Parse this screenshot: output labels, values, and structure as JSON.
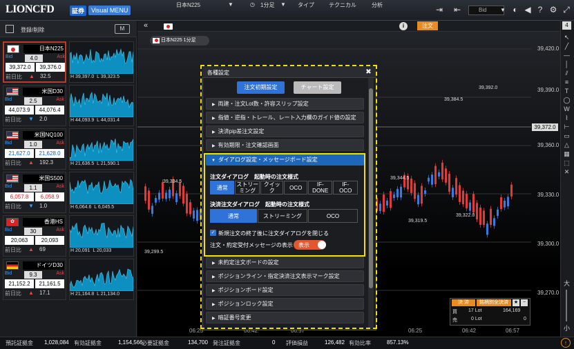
{
  "app": {
    "logo": "LIONCFD",
    "logo_badge": "証券",
    "visual_menu": "Visual MENU",
    "bid_select": "Bid"
  },
  "watchlist": {
    "title": "登録/削除",
    "m_button": "M",
    "tiles": [
      {
        "name": "日本N225",
        "flag": "jp",
        "bid_label": "Bid",
        "ask_label": "Ask",
        "spread": "4.0",
        "bid": "39,372.0",
        "ask": "39,376.0",
        "prev_label": "前日比",
        "direction": "up",
        "change": "32.5",
        "high": "H 39,397.0",
        "low": "L 39,323.5",
        "bid_color": "normal",
        "ask_color": "normal",
        "selected": true
      },
      {
        "name": "米国D30",
        "flag": "us",
        "bid_label": "Bid",
        "ask_label": "Ask",
        "spread": "2.5",
        "bid": "44,073.9",
        "ask": "44,076.4",
        "prev_label": "前日比",
        "direction": "down",
        "change": "2.0",
        "high": "H 44,093.9",
        "low": "L 44,031.4",
        "bid_color": "normal",
        "ask_color": "normal",
        "selected": false
      },
      {
        "name": "米国NQ100",
        "flag": "us",
        "bid_label": "Bid",
        "ask_label": "Ask",
        "spread": "1.0",
        "bid": "21,627.0",
        "ask": "21,628.0",
        "prev_label": "前日比",
        "direction": "up",
        "change": "192.3",
        "high": "H 21,636.5",
        "low": "L 21,590.1",
        "bid_color": "blue",
        "ask_color": "blue",
        "selected": false
      },
      {
        "name": "米国S500",
        "flag": "us",
        "bid_label": "Bid",
        "ask_label": "Ask",
        "spread": "1.1",
        "bid": "6,057.8",
        "ask": "6,058.9",
        "prev_label": "前日比",
        "direction": "down",
        "change": "1.0",
        "high": "H 6,064.6",
        "low": "L 6,045.5",
        "bid_color": "red",
        "ask_color": "red",
        "selected": false
      },
      {
        "name": "香港HS",
        "flag": "hk",
        "bid_label": "Bid",
        "ask_label": "Ask",
        "spread": "30",
        "bid": "20,063",
        "ask": "20,093",
        "prev_label": "前日比",
        "direction": "up",
        "change": "69",
        "high": "H 20,091",
        "low": "L 20,033",
        "bid_color": "normal",
        "ask_color": "normal",
        "selected": false
      },
      {
        "name": "ドイツD30",
        "flag": "de",
        "bid_label": "Bid",
        "ask_label": "Ask",
        "spread": "9.3",
        "bid": "21,152.2",
        "ask": "21,161.5",
        "prev_label": "前日比",
        "direction": "up",
        "change": "17.1",
        "high": "H 21,164.8",
        "low": "L 21,134.0",
        "bid_color": "normal",
        "ask_color": "normal",
        "selected": false
      }
    ]
  },
  "chart_toolbar": {
    "symbol": "日本N225",
    "interval": "1分足",
    "type": "タイプ",
    "technical": "テクニカル",
    "analysis": "分析",
    "info": "i",
    "order": "注文"
  },
  "chart": {
    "title_pill": "日本N225 1分足",
    "price_labels": [
      "39,420.0",
      "39,390.0",
      "39,360.0",
      "39,330.0",
      "39,300.0",
      "39,270.0"
    ],
    "current_price": "39,372.0",
    "time_labels": [
      "06:25",
      "06:42",
      "06:57",
      "06:25",
      "06:42",
      "06:57"
    ],
    "annotations": [
      "39,334.5",
      "39,299.5",
      "39,392.0",
      "39,384.5",
      "39,344.5",
      "39,319.5",
      "39,322.0"
    ]
  },
  "order_panel": {
    "settle": "決 済",
    "by_symbol": "銘柄別全決済",
    "buy_label": "買",
    "buy_lot": "17 Lot",
    "buy_price": "164,169",
    "sell_label": "売",
    "sell_lot": "0 Lot",
    "sell_price": "0"
  },
  "dialog": {
    "title": "各種設定",
    "tab_order": "注文初期設定",
    "tab_chart": "チャート設定",
    "sections_top": [
      "両建・注文Lot数・許容スリップ設定",
      "指値・逆指・トレール、レート入力欄のガイド値の設定",
      "決済pip差注文設定",
      "有効期限・注文確認画面"
    ],
    "open_section": "ダイアログ設定・メッセージボード設定",
    "order_dialog_label": "注文ダイアログ　起動時の注文様式",
    "order_modes": [
      "通常",
      "ストリー\nミング",
      "クイック",
      "OCO",
      "IF-\nDONE",
      "IF-\nOCO"
    ],
    "settle_dialog_label": "決済注文ダイアログ　起動時の注文様式",
    "settle_modes": [
      "通常",
      "ストリーミング",
      "OCO"
    ],
    "checkbox_label": "新規注文の終了後に注文ダイアログを閉じる",
    "message_label": "注文・約定受付メッセージの表示",
    "toggle_label": "表示",
    "sections_bottom": [
      "未約定注文ボードの設定",
      "ポジションライン・指定決済注文表示マーク設定",
      "ポジションボード設定",
      "ポジションロック設定",
      "暗証番号変更"
    ]
  },
  "footer": {
    "items": [
      {
        "label": "預託証拠金",
        "value": "1,028,084"
      },
      {
        "label": "有効証拠金",
        "value": "1,154,566"
      },
      {
        "label": "必要証拠金",
        "value": "134,700"
      },
      {
        "label": "発注証拠金",
        "value": "0"
      },
      {
        "label": "評価損益",
        "value": "126,482"
      },
      {
        "label": "有効比率",
        "value": "857.13%"
      }
    ]
  },
  "sidebar_count": "4"
}
